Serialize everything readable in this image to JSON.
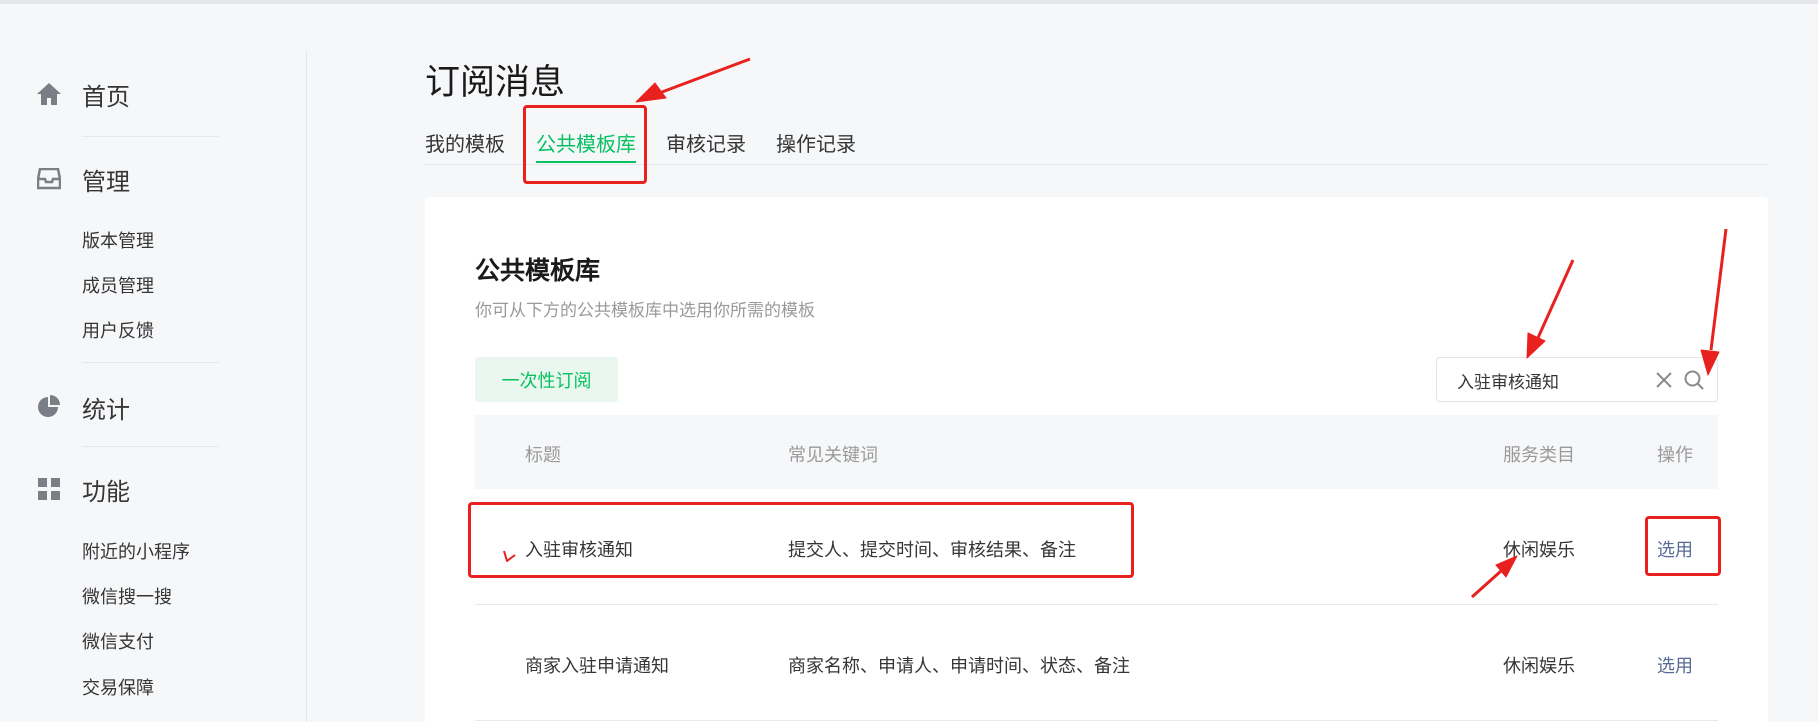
{
  "sidebar": {
    "home": {
      "label": "首页",
      "icon": "home-icon"
    },
    "manage": {
      "label": "管理",
      "icon": "inbox-icon",
      "items": [
        "版本管理",
        "成员管理",
        "用户反馈"
      ]
    },
    "stats": {
      "label": "统计",
      "icon": "pie-chart-icon"
    },
    "features": {
      "label": "功能",
      "icon": "grid-icon",
      "items": [
        "附近的小程序",
        "微信搜一搜",
        "微信支付",
        "交易保障"
      ]
    }
  },
  "page": {
    "title": "订阅消息",
    "tabs": [
      "我的模板",
      "公共模板库",
      "审核记录",
      "操作记录"
    ],
    "active_tab": "公共模板库"
  },
  "library": {
    "title": "公共模板库",
    "description": "你可从下方的公共模板库中选用你所需的模板",
    "filter_label": "一次性订阅",
    "search_value": "入驻审核通知"
  },
  "table": {
    "headers": {
      "title": "标题",
      "keywords": "常见关键词",
      "category": "服务类目",
      "action": "操作"
    },
    "rows": [
      {
        "title": "入驻审核通知",
        "keywords": "提交人、提交时间、审核结果、备注",
        "category": "休闲娱乐",
        "action": "选用"
      },
      {
        "title": "商家入驻申请通知",
        "keywords": "商家名称、申请人、申请时间、状态、备注",
        "category": "休闲娱乐",
        "action": "选用"
      }
    ]
  },
  "colors": {
    "accent": "#07c160",
    "link": "#576b95",
    "annotation": "#e8211f"
  }
}
